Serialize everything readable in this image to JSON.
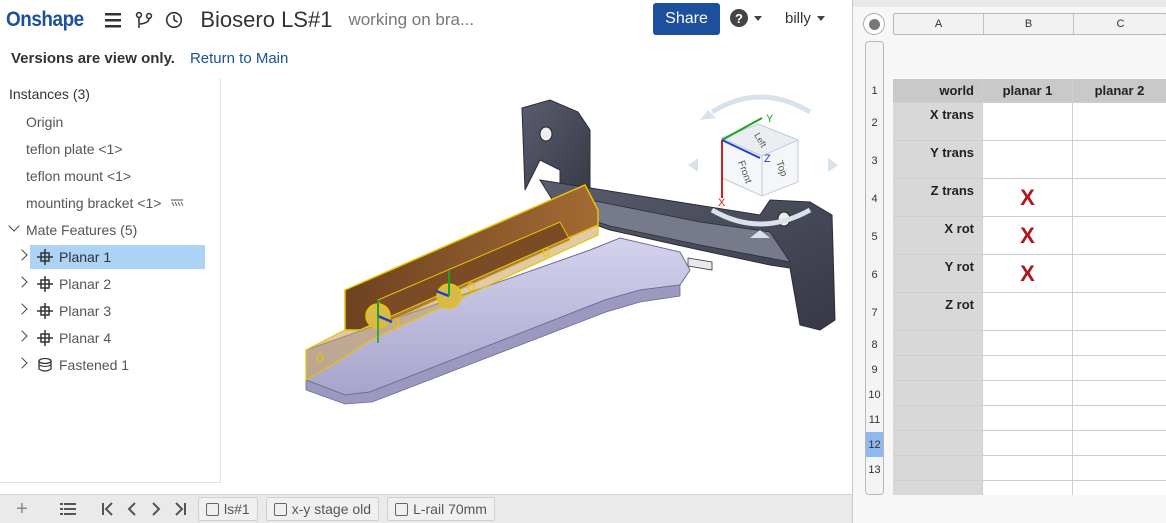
{
  "topbar": {
    "logo": "Onshape",
    "doc_title": "Biosero LS#1",
    "doc_description": "working on bra...",
    "share_label": "Share",
    "user_name": "billy"
  },
  "version_bar": {
    "message": "Versions are view only.",
    "return_link": "Return to Main"
  },
  "tree": {
    "header": "Instances (3)",
    "instances": [
      "Origin",
      "teflon plate <1>",
      "teflon mount <1>",
      "mounting bracket <1>"
    ],
    "mate_features_label": "Mate Features (5)",
    "mates": [
      {
        "label": "Planar 1",
        "icon": "planar-mate-icon",
        "selected": true
      },
      {
        "label": "Planar 2",
        "icon": "planar-mate-icon",
        "selected": false
      },
      {
        "label": "Planar 3",
        "icon": "planar-mate-icon",
        "selected": false
      },
      {
        "label": "Planar 4",
        "icon": "planar-mate-icon",
        "selected": false
      },
      {
        "label": "Fastened 1",
        "icon": "fastened-mate-icon",
        "selected": false
      }
    ]
  },
  "view_cube": {
    "faces": [
      "Top",
      "Front",
      "Left"
    ],
    "axes": [
      "X",
      "Y",
      "Z"
    ]
  },
  "bottombar": {
    "tabs": [
      "ls#1",
      "x-y stage old",
      "L-rail 70mm"
    ]
  },
  "spreadsheet": {
    "columns": [
      "A",
      "B",
      "C"
    ],
    "rows": [
      "1",
      "2",
      "3",
      "4",
      "5",
      "6",
      "7",
      "8",
      "9",
      "10",
      "11",
      "12",
      "13"
    ],
    "active_row": "12",
    "header_row": [
      "world",
      "planar 1",
      "planar 2"
    ],
    "row_labels": [
      "X trans",
      "Y trans",
      "Z trans",
      "X rot",
      "Y rot",
      "Z rot"
    ],
    "marks": [
      {
        "row": "Z trans",
        "col": "planar 1",
        "value": "X"
      },
      {
        "row": "X rot",
        "col": "planar 1",
        "value": "X"
      },
      {
        "row": "Y rot",
        "col": "planar 1",
        "value": "X"
      }
    ],
    "mark_color": "#b0161d"
  },
  "colors": {
    "brand": "#1c4f9c",
    "selection": "#acd2f5",
    "part_purple": "#b9b6dc",
    "part_dark": "#4a4d5c",
    "part_brown": "#8a5a2b"
  }
}
